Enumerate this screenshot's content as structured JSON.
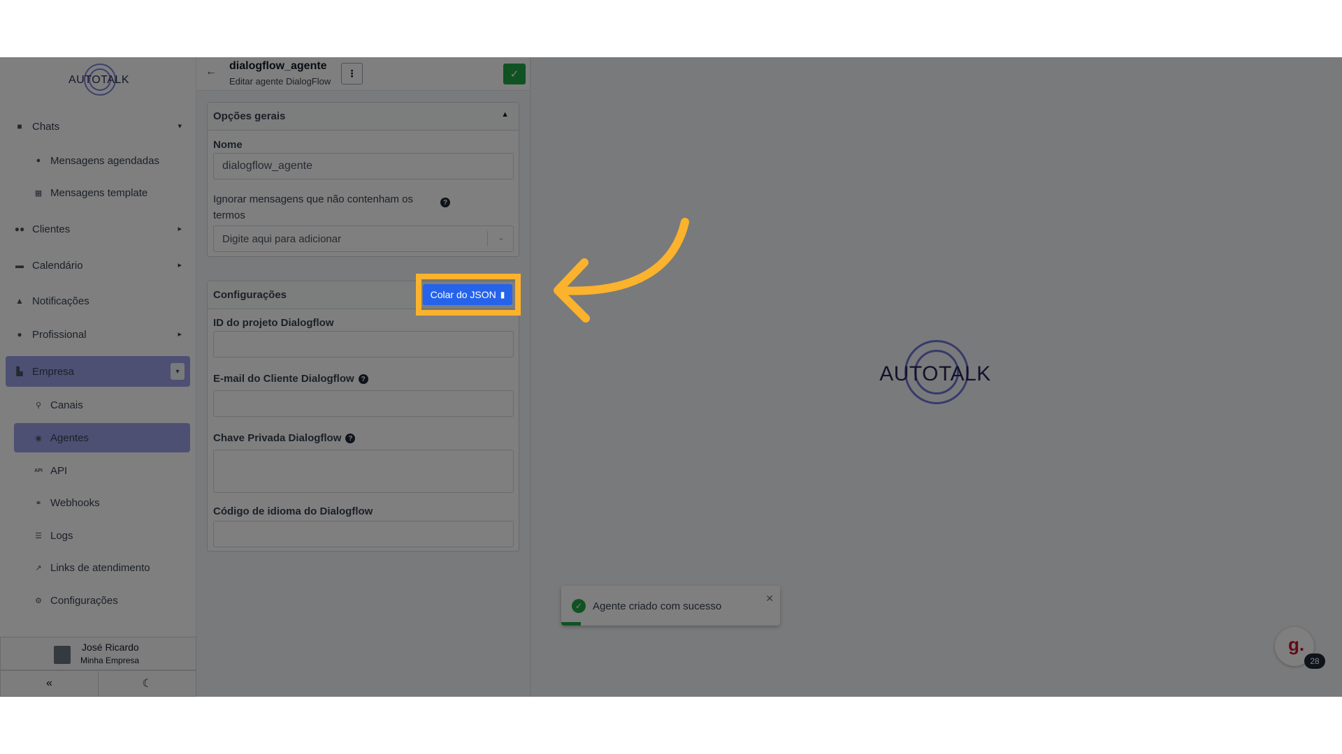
{
  "colors": {
    "accent": "#9aa1e6",
    "primary_button": "#2563eb",
    "success": "#22a447",
    "highlight": "#fbb22c"
  },
  "sidebar": {
    "logo_text": "AUTOTALK",
    "items": [
      {
        "label": "Chats",
        "icon": "chat-icon",
        "arrow": "▾"
      },
      {
        "label": "Mensagens agendadas",
        "icon": "clock-icon"
      },
      {
        "label": "Mensagens template",
        "icon": "template-icon"
      },
      {
        "label": "Clientes",
        "icon": "users-icon",
        "arrow": "▸"
      },
      {
        "label": "Calendário",
        "icon": "calendar-icon",
        "arrow": "▸"
      },
      {
        "label": "Notificações",
        "icon": "bell-icon"
      },
      {
        "label": "Profissional",
        "icon": "user-cog-icon",
        "arrow": "▸"
      },
      {
        "label": "Empresa",
        "icon": "building-icon",
        "arrow": "▾"
      },
      {
        "label": "Canais",
        "icon": "plug-icon"
      },
      {
        "label": "Agentes",
        "icon": "robot-icon"
      },
      {
        "label": "API",
        "icon": "api-icon"
      },
      {
        "label": "Webhooks",
        "icon": "webhook-icon"
      },
      {
        "label": "Logs",
        "icon": "list-icon"
      },
      {
        "label": "Links de atendimento",
        "icon": "external-link-icon"
      },
      {
        "label": "Configurações",
        "icon": "gear-icon"
      }
    ],
    "user_name": "José Ricardo",
    "user_company": "Minha Empresa"
  },
  "editor": {
    "title": "dialogflow_agente",
    "subtitle": "Editar agente DialogFlow",
    "general_section": "Opções gerais",
    "name_label": "Nome",
    "name_value": "dialogflow_agente",
    "ignore_label": "Ignorar mensagens que não contenham os termos",
    "ignore_placeholder": "Digite aqui para adicionar",
    "config_section": "Configurações",
    "paste_json_label": "Colar do JSON",
    "project_id_label": "ID do projeto Dialogflow",
    "client_email_label": "E-mail do Cliente Dialogflow",
    "private_key_label": "Chave Privada Dialogflow",
    "language_label": "Código de idioma do Dialogflow"
  },
  "main": {
    "logo_text": "AUTOTALK"
  },
  "toast": {
    "message": "Agente criado com sucesso",
    "progress": 0.09
  },
  "chat_widget": {
    "logo": "g.",
    "badge": "28"
  }
}
